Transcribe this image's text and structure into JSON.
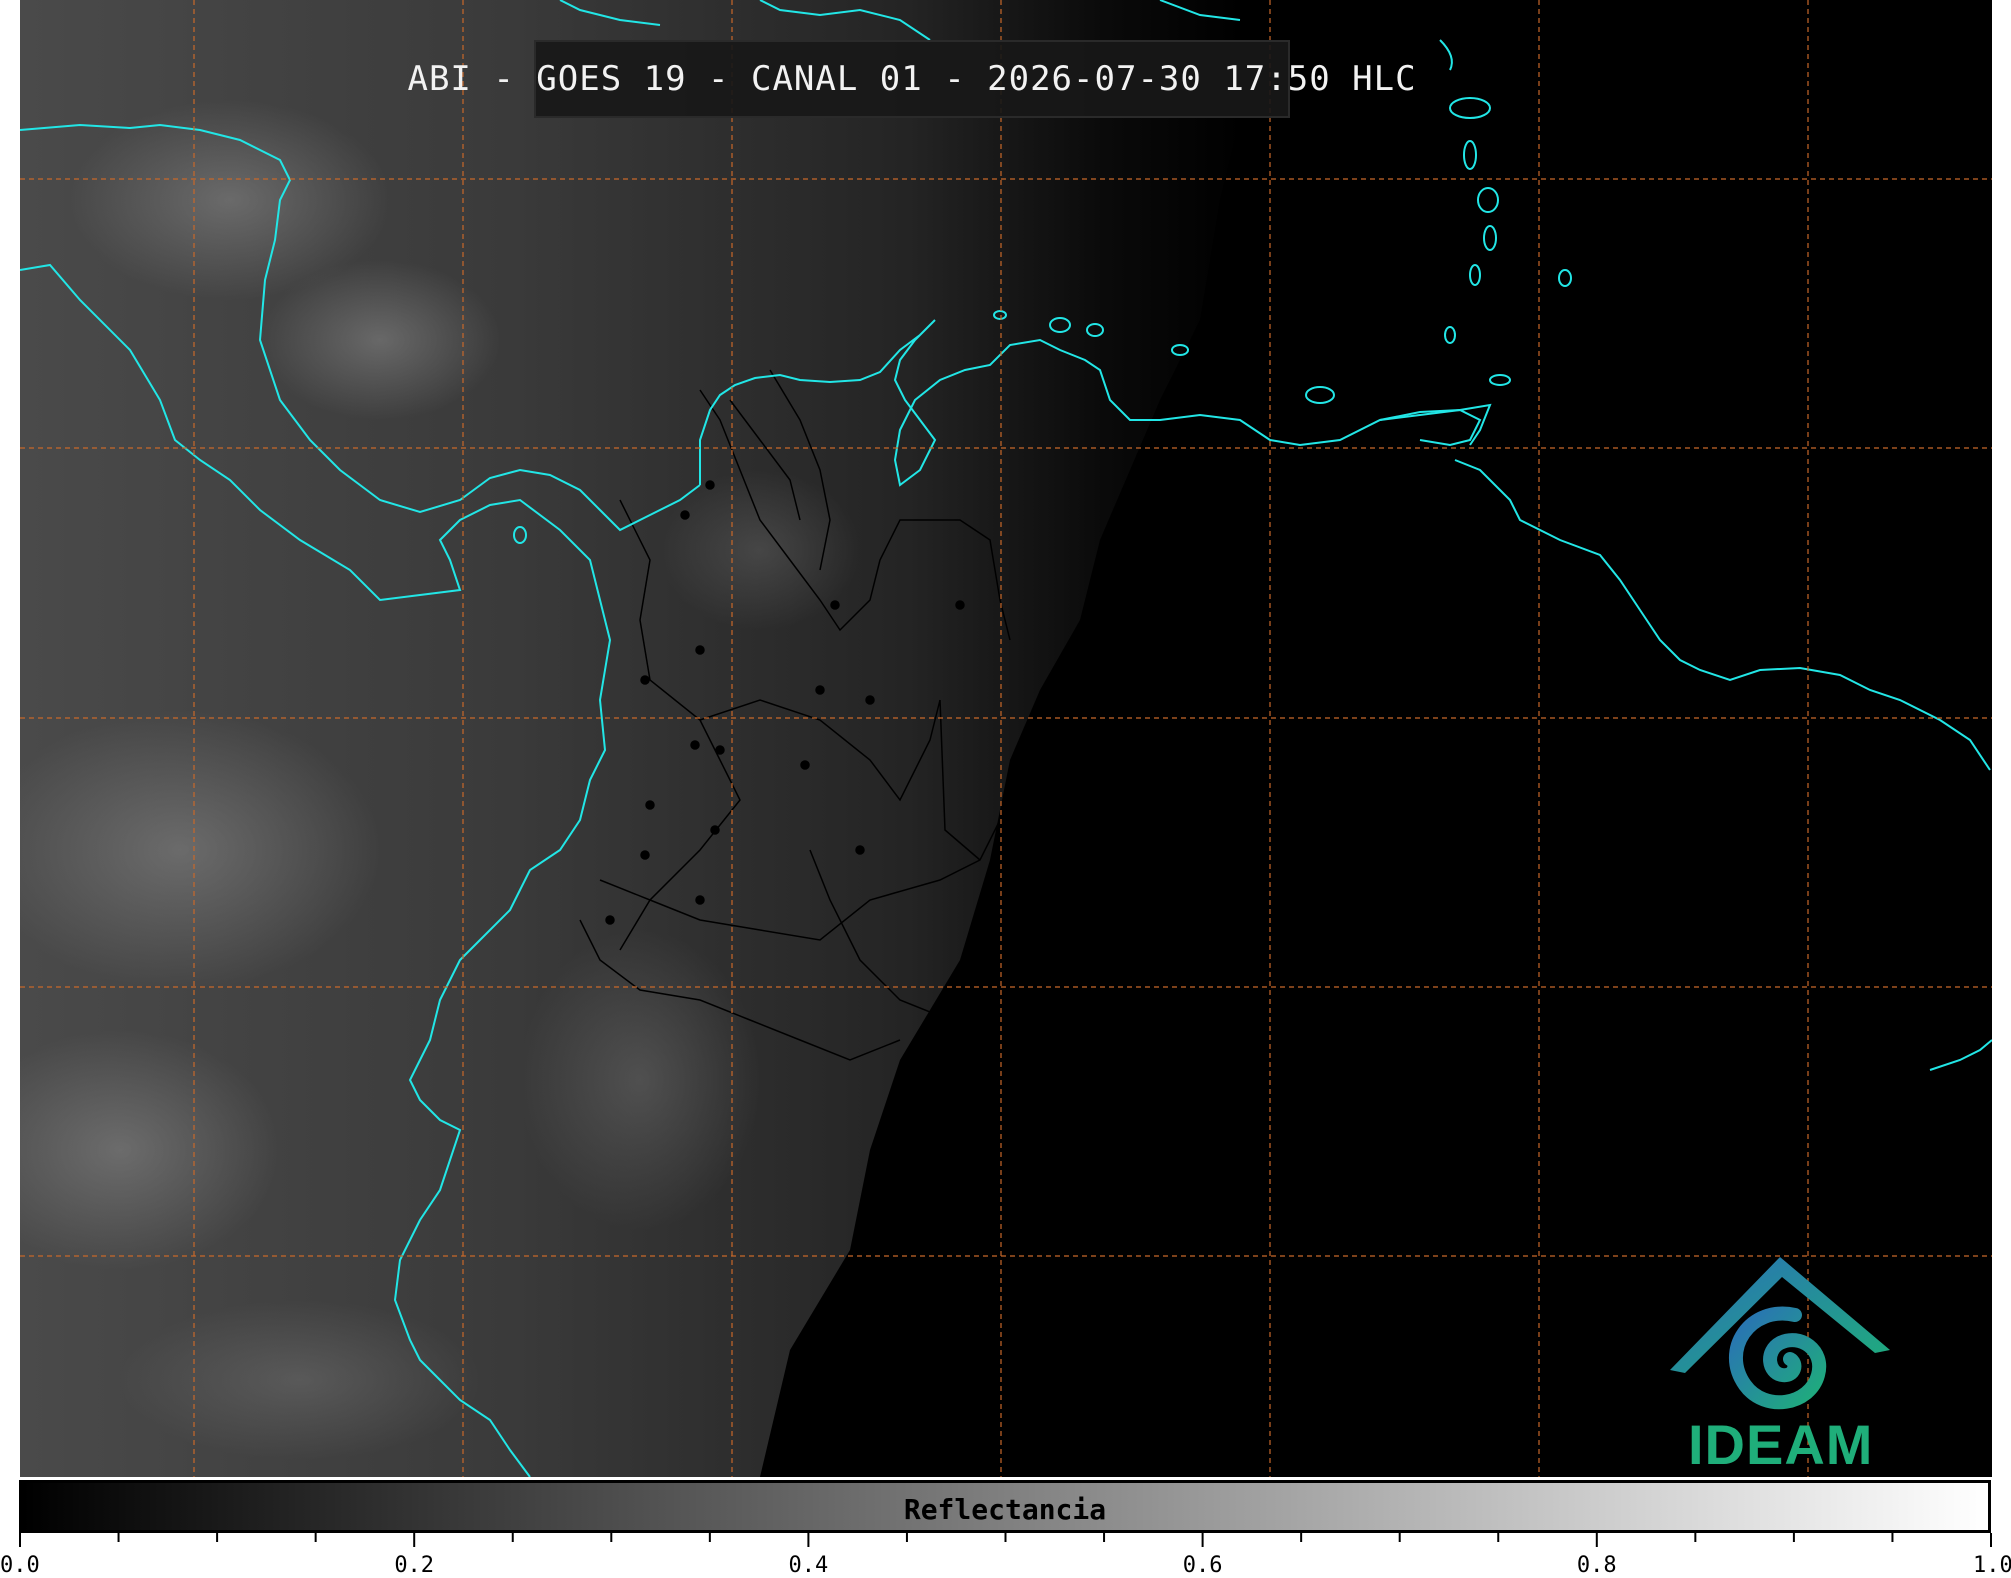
{
  "title": "ABI - GOES 19 - CANAL 01 - 2026-07-30 17:50 HLC",
  "colorbar": {
    "label": "Reflectancia",
    "min": 0.0,
    "max": 1.0,
    "tick_labels": [
      "0.0",
      "0.2",
      "0.4",
      "0.6",
      "0.8",
      "1.0"
    ],
    "tick_values": [
      0.0,
      0.2,
      0.4,
      0.6,
      0.8,
      1.0
    ],
    "minor_step": 0.05
  },
  "logo": {
    "text": "IDEAM"
  },
  "colors": {
    "coastline": "#22e6e6",
    "grid": "#c8682a",
    "borders": "#000000",
    "logo_green": "#1fae7a",
    "logo_blue": "#2a6fb8"
  }
}
